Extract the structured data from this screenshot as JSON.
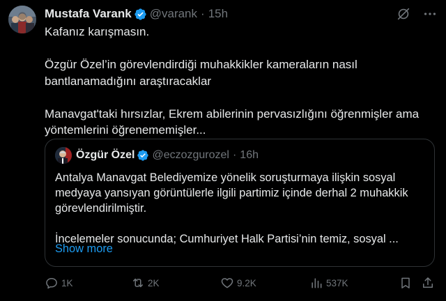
{
  "tweet": {
    "author": {
      "display_name": "Mustafa Varank",
      "handle": "@varank",
      "time": "15h"
    },
    "paragraphs": [
      [
        "Kafanız karışmasın."
      ],
      [
        "Özgür Özel’in görevlendirdiği muhakkikler kameraların nasıl",
        "bantlanamadığını araştıracaklar"
      ],
      [
        "Manavgat'taki hırsızlar, Ekrem abilerinin pervasızlığını öğrenmişler ama",
        "yöntemlerini öğrenememişler..."
      ]
    ],
    "quote": {
      "display_name": "Özgür Özel",
      "handle": "@eczozgurozel",
      "time": "16h",
      "paragraphs": [
        [
          "Antalya Manavgat Belediyemize yönelik soruşturmaya ilişkin sosyal",
          "medyaya yansıyan görüntülerle ilgili partimiz içinde derhal 2 muhakkik",
          "görevlendirilmiştir."
        ],
        [
          "İncelemeler sonucunda; Cumhuriyet Halk Partisi’nin temiz, sosyal ..."
        ]
      ],
      "show_more": "Show more"
    },
    "actions": {
      "replies": "1K",
      "reposts": "2K",
      "likes": "9.2K",
      "views": "537K"
    }
  },
  "colors": {
    "background": "#000000",
    "text": "#e7e9ea",
    "muted": "#71767b",
    "accent": "#1d9bf0",
    "border": "#2f3336"
  }
}
